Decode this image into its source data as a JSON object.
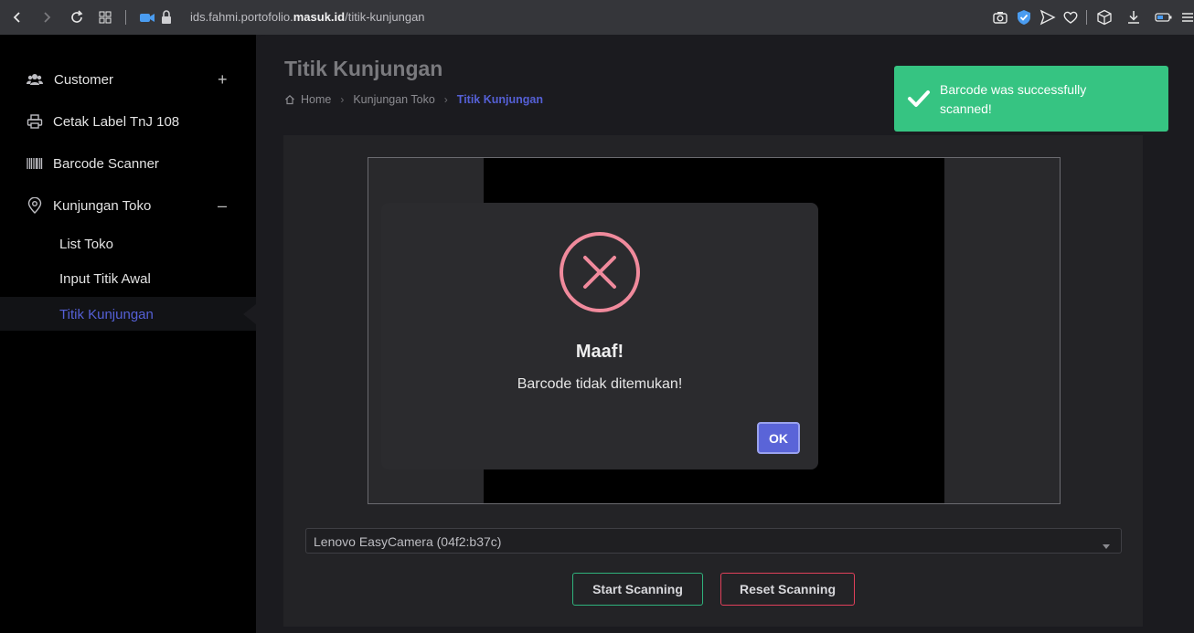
{
  "browser": {
    "url_prefix": "ids.fahmi.portofolio.",
    "url_domain": "masuk.id",
    "url_path": "/titik-kunjungan"
  },
  "sidebar": {
    "items": [
      {
        "label": "Customer",
        "icon": "users-icon",
        "toggle": "+"
      },
      {
        "label": "Cetak Label TnJ 108",
        "icon": "printer-icon"
      },
      {
        "label": "Barcode Scanner",
        "icon": "barcode-icon"
      },
      {
        "label": "Kunjungan Toko",
        "icon": "map-pin-icon",
        "toggle": "–"
      }
    ],
    "subitems": [
      {
        "label": "List Toko"
      },
      {
        "label": "Input Titik Awal"
      },
      {
        "label": "Titik Kunjungan",
        "active": true
      }
    ],
    "active_color": "#5560d6"
  },
  "page": {
    "title": "Titik Kunjungan",
    "breadcrumb": [
      "Home",
      "Kunjungan Toko",
      "Titik Kunjungan"
    ]
  },
  "camera": {
    "selected": "Lenovo EasyCamera (04f2:b37c)"
  },
  "actions": {
    "start": "Start Scanning",
    "reset": "Reset Scanning"
  },
  "toast": {
    "message": "Barcode was successfully scanned!",
    "color": "#36c482"
  },
  "modal": {
    "icon": "error-x-icon",
    "title": "Maaf!",
    "text": "Barcode tidak ditemukan!",
    "ok_label": "OK"
  }
}
